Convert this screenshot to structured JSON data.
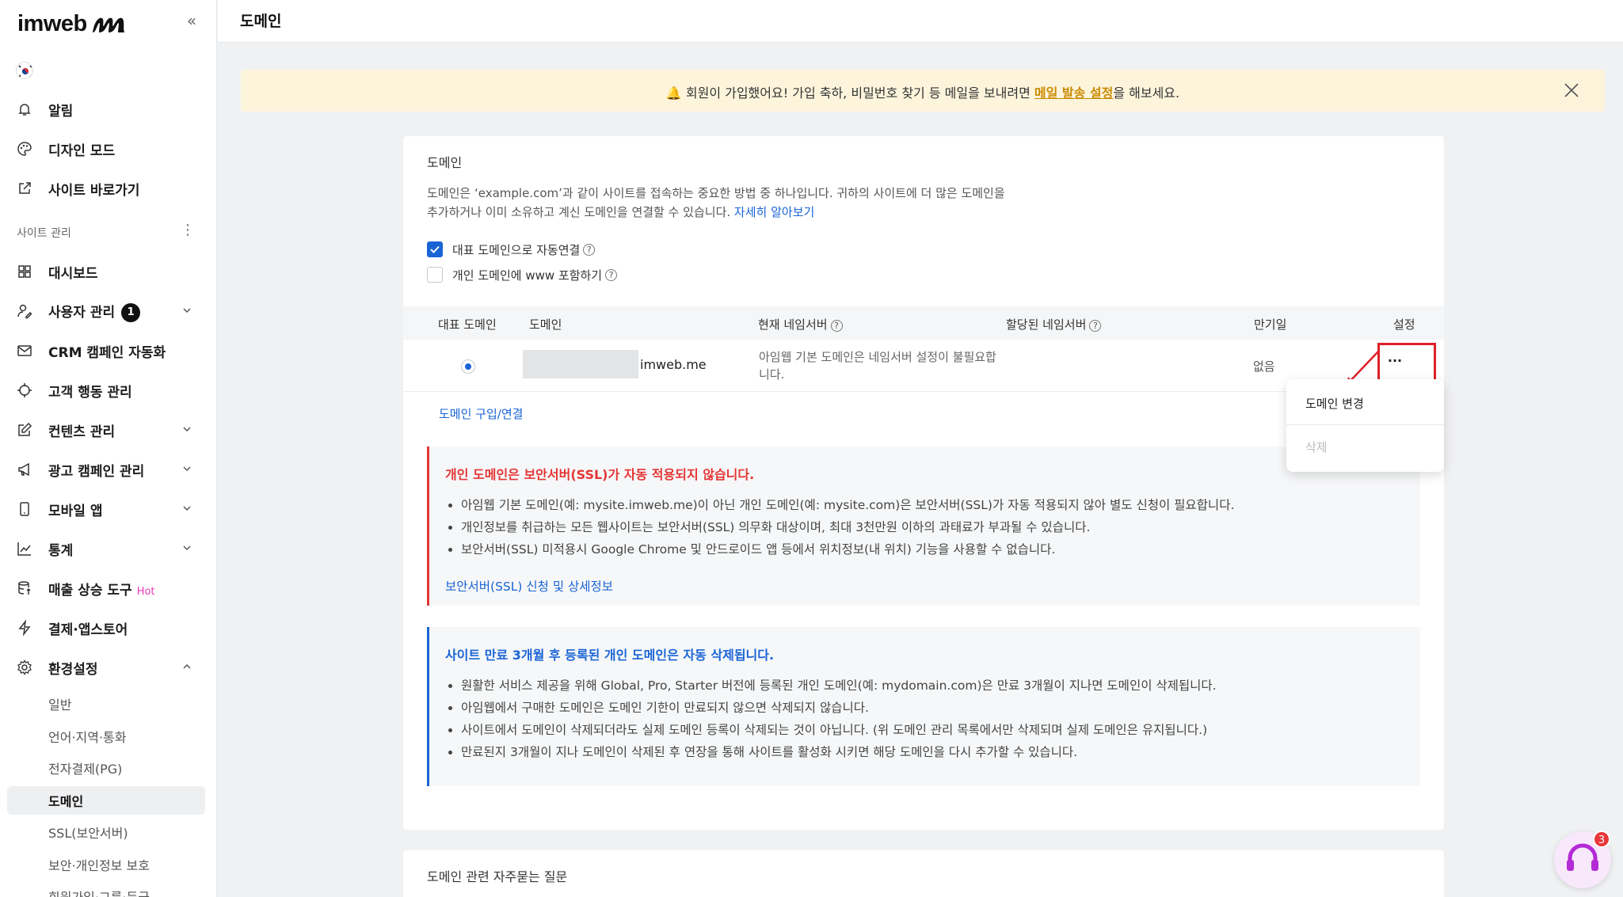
{
  "sidebar": {
    "logo_text": "imweb",
    "items": [
      {
        "label": "알림"
      },
      {
        "label": "디자인 모드"
      },
      {
        "label": "사이트 바로가기"
      }
    ],
    "section_label": "사이트 관리",
    "manage_items": [
      {
        "label": "대시보드"
      },
      {
        "label": "사용자 관리",
        "badge": "1"
      },
      {
        "label": "CRM 캠페인 자동화"
      },
      {
        "label": "고객 행동 관리"
      },
      {
        "label": "컨텐츠 관리"
      },
      {
        "label": "광고 캠페인 관리"
      },
      {
        "label": "모바일 앱"
      },
      {
        "label": "통계"
      },
      {
        "label": "매출 상승 도구",
        "tag": "Hot"
      },
      {
        "label": "결제·앱스토어"
      },
      {
        "label": "환경설정"
      }
    ],
    "sub_items": [
      {
        "label": "일반"
      },
      {
        "label": "언어·지역·통화"
      },
      {
        "label": "전자결제(PG)"
      },
      {
        "label": "도메인"
      },
      {
        "label": "SSL(보안서버)"
      },
      {
        "label": "보안·개인정보 보호"
      },
      {
        "label": "회원가입·그룹·등급"
      }
    ]
  },
  "header": {
    "title": "도메인"
  },
  "notice": {
    "text_before": "회원이 가입했어요! 가입 축하, 비밀번호 찾기 등 메일을 보내려면 ",
    "link": "메일 발송 설정",
    "text_after": "을 해보세요."
  },
  "domain_card": {
    "title": "도메인",
    "description": "도메인은 ‘example.com’과 같이 사이트를 접속하는 중요한 방법 중 하나입니다. 귀하의 사이트에 더 많은 도메인을 추가하거나 이미 소유하고 계신 도메인을 연결할 수 있습니다. ",
    "learn_more": "자세히 알아보기",
    "checkbox_auto": {
      "label": "대표 도메인으로 자동연결",
      "checked": true
    },
    "checkbox_www": {
      "label": "개인 도메인에 www 포함하기",
      "checked": false
    },
    "columns": [
      "대표 도메인",
      "도메인",
      "현재 네임서버",
      "할당된 네임서버",
      "만기일",
      "설정"
    ],
    "row": {
      "domain_suffix": "imweb.me",
      "nameserver": "아임웹 기본 도메인은 네임서버 설정이 불필요합니다.",
      "expiry": "없음",
      "more": "···"
    },
    "buy_link": "도메인 구입/연결",
    "ssl_box": {
      "title": "개인 도메인은 보안서버(SSL)가 자동 적용되지 않습니다.",
      "items": [
        "아임웹 기본 도메인(예: mysite.imweb.me)이 아닌 개인 도메인(예: mysite.com)은 보안서버(SSL)가 자동 적용되지 않아 별도 신청이 필요합니다.",
        "개인정보를 취급하는 모든 웹사이트는 보안서버(SSL) 의무화 대상이며, 최대 3천만원 이하의 과태료가 부과될 수 있습니다.",
        "보안서버(SSL) 미적용시 Google Chrome 및 안드로이드 앱 등에서 위치정보(내 위치) 기능을 사용할 수 없습니다."
      ],
      "link": "보안서버(SSL) 신청 및 상세정보"
    },
    "expire_box": {
      "title": "사이트 만료 3개월 후 등록된 개인 도메인은 자동 삭제됩니다.",
      "items": [
        "원활한 서비스 제공을 위해 Global, Pro, Starter 버전에 등록된 개인 도메인(예: mydomain.com)은 만료 3개월이 지나면 도메인이 삭제됩니다.",
        "아임웹에서 구매한 도메인은 도메인 기한이 만료되지 않으면 삭제되지 않습니다.",
        "사이트에서 도메인이 삭제되더라도 실제 도메인 등록이 삭제되는 것이 아닙니다. (위 도메인 관리 목록에서만 삭제되며 실제 도메인은 유지됩니다.)",
        "만료된지 3개월이 지나 도메인이 삭제된 후 연장을 통해 사이트를 활성화 시키면 해당 도메인을 다시 추가할 수 있습니다."
      ]
    }
  },
  "dropdown": {
    "change": "도메인 변경",
    "delete": "삭제"
  },
  "faq": {
    "title": "도메인 관련 자주묻는 질문"
  },
  "support": {
    "badge": "3"
  },
  "colors": {
    "accent": "#1a64d6",
    "danger": "#e53535",
    "highlight": "#e0202a",
    "notice_bg": "#fdf4dc"
  }
}
